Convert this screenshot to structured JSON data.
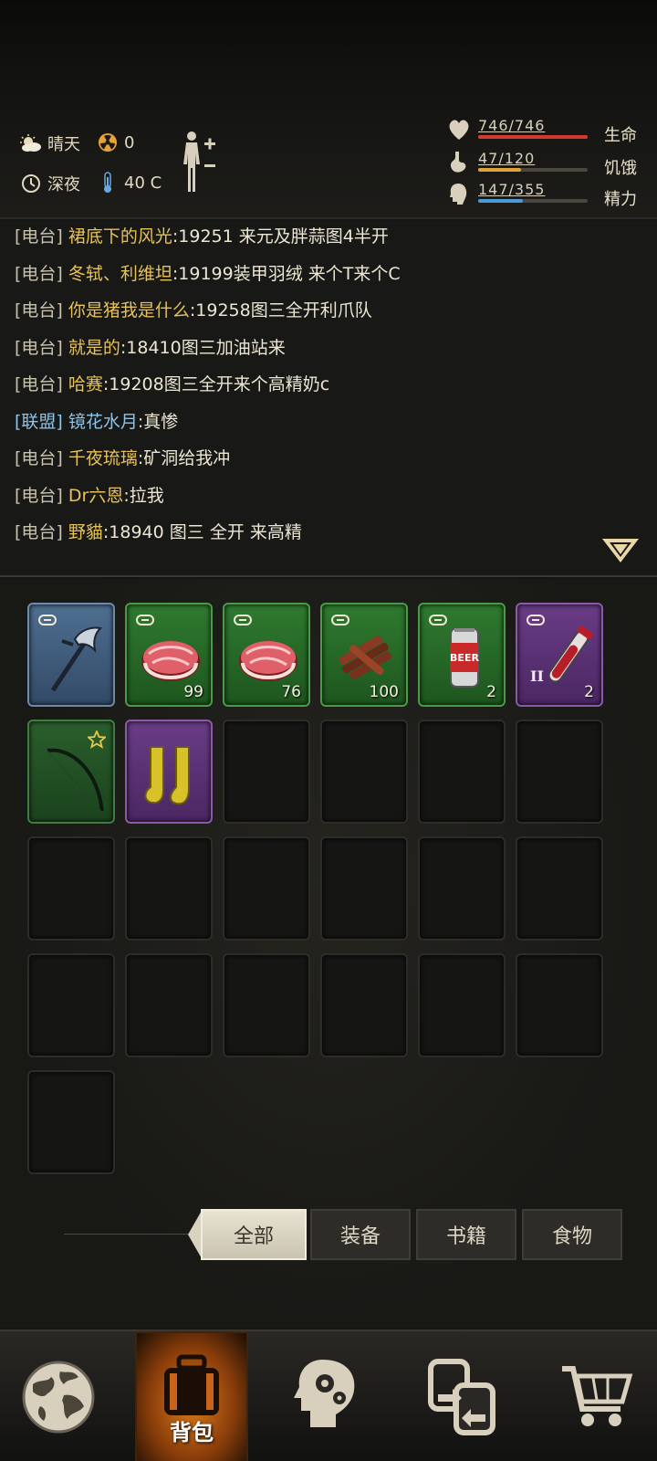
{
  "status": {
    "weather": "晴天",
    "radiation": "0",
    "time": "深夜",
    "temperature": "40 C"
  },
  "stats": [
    {
      "name": "health",
      "label": "生命",
      "value": "746/746",
      "fraction": 1.0,
      "color": "#d23a2e"
    },
    {
      "name": "hunger",
      "label": "饥饿",
      "value": "47/120",
      "fraction": 0.39,
      "color": "#e0a23a"
    },
    {
      "name": "energy",
      "label": "精力",
      "value": "147/355",
      "fraction": 0.41,
      "color": "#4a9ad8"
    }
  ],
  "chat": [
    {
      "channel": "[电台]",
      "name": "裙底下的风光",
      "message": ":19251 来元及胖蒜图4半开",
      "type": "radio"
    },
    {
      "channel": "[电台]",
      "name": "冬轼、利维坦",
      "message": ":19199装甲羽绒 来个T来个C",
      "type": "radio"
    },
    {
      "channel": "[电台]",
      "name": "你是猪我是什么",
      "message": ":19258图三全开利爪队",
      "type": "radio"
    },
    {
      "channel": "[电台]",
      "name": "就是的",
      "message": ":18410图三加油站来",
      "type": "radio"
    },
    {
      "channel": "[电台]",
      "name": "哈赛",
      "message": ":19208图三全开来个高精奶c",
      "type": "radio"
    },
    {
      "channel": "[联盟]",
      "name": "镜花水月",
      "message": ":真惨",
      "type": "alliance"
    },
    {
      "channel": "[电台]",
      "name": "千夜琉璃",
      "message": ":矿洞给我冲",
      "type": "radio"
    },
    {
      "channel": "[电台]",
      "name": "Dr六恩",
      "message": ":拉我",
      "type": "radio"
    },
    {
      "channel": "[电台]",
      "name": "野貓",
      "message": ":18940 图三 全开 来高精",
      "type": "radio"
    }
  ],
  "inventory": [
    {
      "item": "pickaxe-icon",
      "rarity": "blue",
      "qty": "",
      "linked": true
    },
    {
      "item": "raw-meat-icon",
      "rarity": "green",
      "qty": "99",
      "linked": true
    },
    {
      "item": "raw-meat-icon",
      "rarity": "green",
      "qty": "76",
      "linked": true
    },
    {
      "item": "jerky-icon",
      "rarity": "green",
      "qty": "100",
      "linked": true
    },
    {
      "item": "beer-can-icon",
      "rarity": "green",
      "qty": "2",
      "linked": true
    },
    {
      "item": "blood-vial-icon",
      "rarity": "purple",
      "qty": "2",
      "linked": true,
      "tier": "II"
    },
    {
      "item": "bow-icon",
      "rarity": "dgreen",
      "qty": "",
      "starred": true
    },
    {
      "item": "rubber-boots-icon",
      "rarity": "purple",
      "qty": ""
    }
  ],
  "empty_slots": 17,
  "filters": [
    {
      "label": "全部",
      "active": true
    },
    {
      "label": "装备",
      "active": false
    },
    {
      "label": "书籍",
      "active": false
    },
    {
      "label": "食物",
      "active": false
    }
  ],
  "nav": [
    {
      "icon": "globe-icon",
      "label": ""
    },
    {
      "icon": "backpack-icon",
      "label": "背包",
      "active": true
    },
    {
      "icon": "head-gears-icon",
      "label": ""
    },
    {
      "icon": "trade-icon",
      "label": ""
    },
    {
      "icon": "cart-icon",
      "label": ""
    }
  ]
}
